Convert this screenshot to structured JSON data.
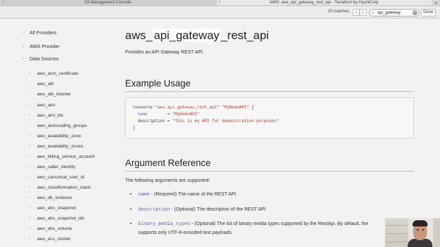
{
  "browser": {
    "tabs": [
      {
        "title": "S3 Management Console",
        "active": false
      },
      {
        "title": "AWS: aws_api_gateway_rest_api - Terraform by HashiCorp",
        "active": true
      }
    ],
    "close_glyph": "×",
    "new_tab_glyph": "+"
  },
  "find_bar": {
    "matches": "20 matches",
    "prev_glyph": "‹",
    "next_glyph": "›",
    "query": "api_gateway",
    "search_glyph": "⌕",
    "clear_glyph": "×",
    "done_label": "Done"
  },
  "sidebar": {
    "bullet": "›",
    "sections": [
      {
        "label": "All Providers"
      },
      {
        "label": "AWS Provider"
      },
      {
        "label": "Data Sources"
      }
    ],
    "items": [
      "aws_acm_certificate",
      "aws_alb",
      "aws_alb_listener",
      "aws_ami",
      "aws_ami_ids",
      "aws_autoscaling_groups",
      "aws_availability_zone",
      "aws_availability_zones",
      "aws_billing_service_account",
      "aws_caller_identity",
      "aws_canonical_user_id",
      "aws_cloudformation_stack",
      "aws_db_instance",
      "aws_ebs_snapshot",
      "aws_ebs_snapshot_ids",
      "aws_ebs_volume",
      "aws_ecs_cluster"
    ]
  },
  "main": {
    "title_pre": "aws_",
    "title_highlight": "api_gateway",
    "title_post": "_rest_api",
    "intro": "Provides an API Gateway REST API.",
    "example_heading": "Example Usage",
    "code": {
      "l1_kw": "resource ",
      "l1_q1": "\"aws_",
      "l1_hl": "api_gateway",
      "l1_q2": "_rest_api\"",
      "l1_name": " \"MyDemoAPI\"",
      "l1_brace": " {",
      "l2_key": "  name",
      "l2_eq": "        = ",
      "l2_val": "\"MyDemoAPI\"",
      "l3_key": "  description",
      "l3_eq": " = ",
      "l3_val": "\"This is my API for demonstration purposes\"",
      "l4": "}"
    },
    "arg_heading": "Argument Reference",
    "arg_intro": "The following arguments are supported:",
    "bullet": "•",
    "args": [
      {
        "name": "name",
        "desc": " - (Required) The name of the REST API"
      },
      {
        "name": "description",
        "desc": " - (Optional) The description of the REST API"
      },
      {
        "name": "binary_media_types",
        "desc": " - (Optional) The list of binary media types supported by the RestApi. By default, the"
      }
    ],
    "arg3_cont": "supports only UTF-8-encoded text payloads."
  }
}
